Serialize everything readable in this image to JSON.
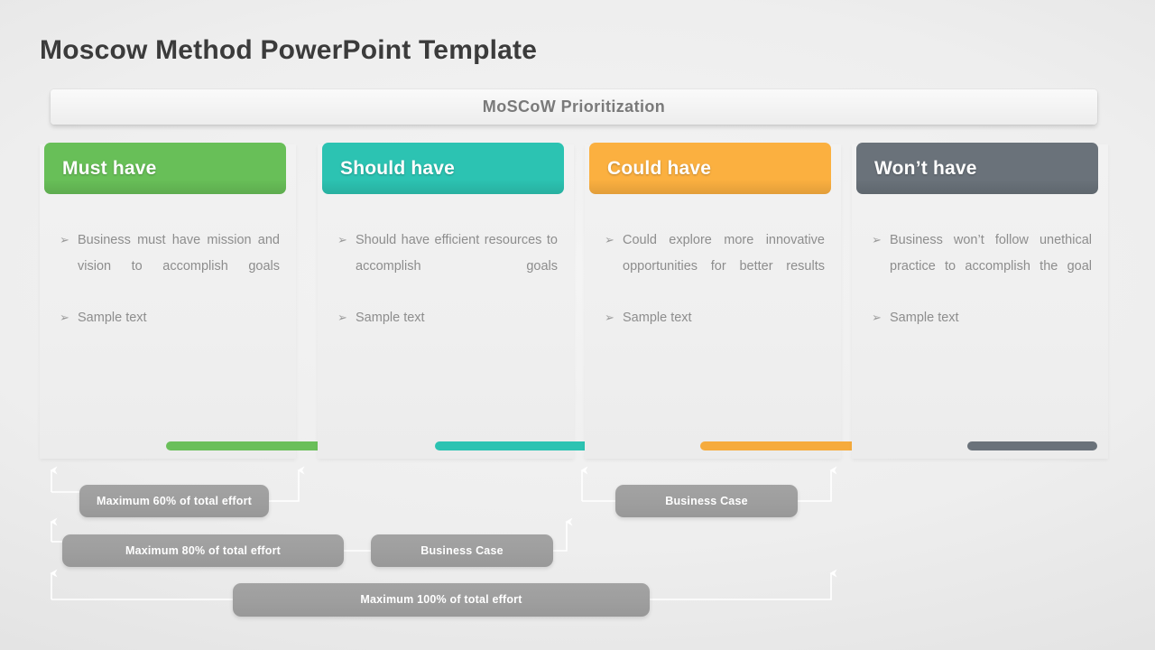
{
  "slide": {
    "title": "Moscow Method PowerPoint Template",
    "banner_label": "MoSCoW Prioritization",
    "background_start": "#f4f4f4",
    "background_end": "#d6d6d6"
  },
  "columns": [
    {
      "header": "Must have",
      "color": "#68bf58",
      "color_dark": "#4a8a3d",
      "accent_color": "#6abf5a",
      "bullets": [
        {
          "marker": "➢",
          "text": "Business must have mission and vision to accomplish goals",
          "justify": true
        },
        {
          "marker": "➢",
          "text": "Sample text",
          "justify": false
        }
      ]
    },
    {
      "header": "Should have",
      "color": "#2cc3b2",
      "color_dark": "#198e81",
      "accent_color": "#2cc3b2",
      "bullets": [
        {
          "marker": "➢",
          "text": "Should have efficient resources to accomplish goals",
          "justify": true
        },
        {
          "marker": "➢",
          "text": "Sample text",
          "justify": false
        }
      ]
    },
    {
      "header": "Could have",
      "color": "#fbb040",
      "color_dark": "#9c6d1d",
      "accent_color": "#f6ab3c",
      "bullets": [
        {
          "marker": "➢",
          "text": "Could explore more innovative opportunities for better results",
          "justify": true
        },
        {
          "marker": "➢",
          "text": "Sample text",
          "justify": false
        }
      ]
    },
    {
      "header": "Won’t have",
      "color": "#6a727a",
      "color_dark": "#3e4348",
      "accent_color": "#6a727a",
      "bullets": [
        {
          "marker": "➢",
          "text": "Business won’t follow unethical practice to accomplish the goal",
          "justify": true
        },
        {
          "marker": "➢",
          "text": "Sample text",
          "justify": false
        }
      ]
    }
  ],
  "brackets": {
    "pill_60": "Maximum  60% of total effort",
    "pill_80": "Maximum  80% of total  effort",
    "pill_business_case_1": "Business  Case",
    "pill_business_case_2": "Business  Case",
    "pill_100": "Maximum  100% of total effort",
    "line_color": "#ffffff",
    "pill_color": "#9e9e9e"
  }
}
